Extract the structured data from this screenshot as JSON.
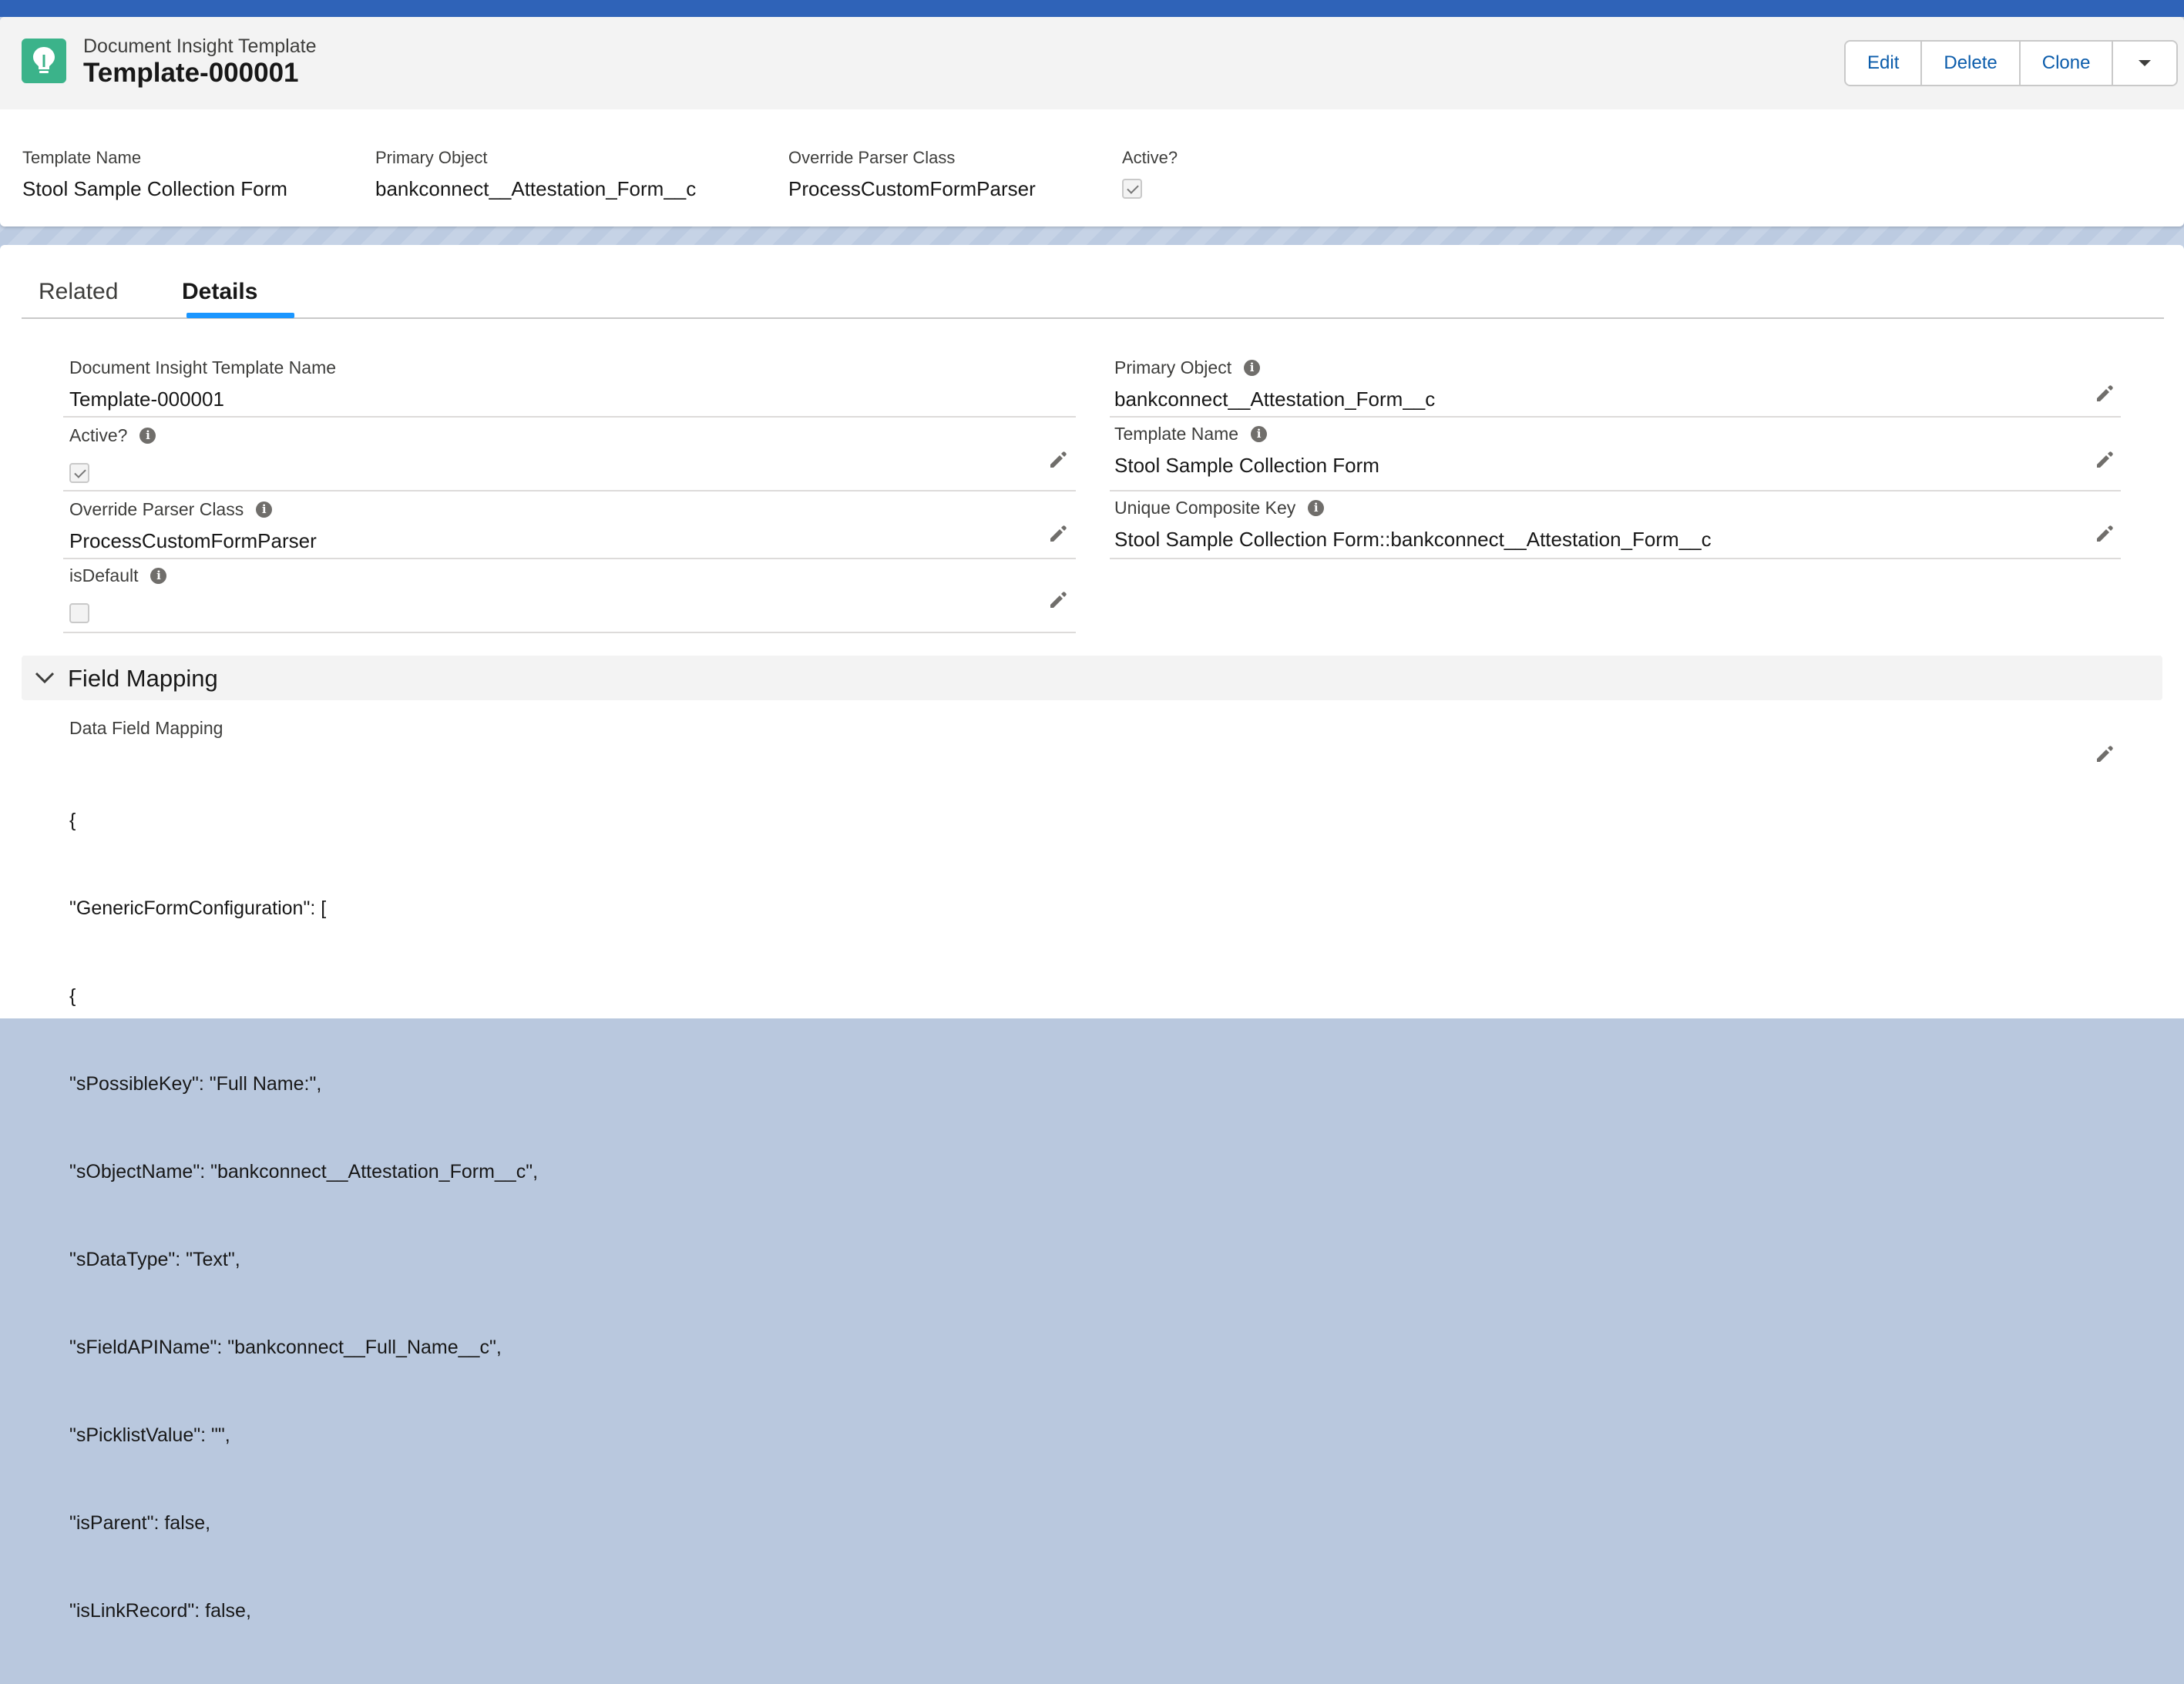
{
  "header": {
    "object_type": "Document Insight Template",
    "record_title": "Template-000001",
    "icon": "lightbulb-icon",
    "actions": [
      "Edit",
      "Delete",
      "Clone"
    ],
    "more_actions_icon": "chevron-down-icon"
  },
  "highlights": [
    {
      "label": "Template Name",
      "value": "Stool Sample Collection Form"
    },
    {
      "label": "Primary Object",
      "value": "bankconnect__Attestation_Form__c"
    },
    {
      "label": "Override Parser Class",
      "value": "ProcessCustomFormParser"
    },
    {
      "label": "Active?",
      "checked": true
    }
  ],
  "tabs": [
    "Related",
    "Details"
  ],
  "active_tab": "Details",
  "details": {
    "left": [
      {
        "label": "Document Insight Template Name",
        "value": "Template-000001",
        "info": false,
        "editable": false
      },
      {
        "label": "Active?",
        "checked": true,
        "info": true,
        "editable": true
      },
      {
        "label": "Override Parser Class",
        "value": "ProcessCustomFormParser",
        "info": true,
        "editable": true
      },
      {
        "label": "isDefault",
        "checked": false,
        "info": true,
        "editable": true
      }
    ],
    "right": [
      {
        "label": "Primary Object",
        "value": "bankconnect__Attestation_Form__c",
        "info": true,
        "editable": true
      },
      {
        "label": "Template Name",
        "value": "Stool Sample Collection Form",
        "info": true,
        "editable": true
      },
      {
        "label": "Unique Composite Key",
        "value": "Stool Sample Collection Form::bankconnect__Attestation_Form__c",
        "info": true,
        "editable": true
      }
    ]
  },
  "field_mapping": {
    "section_title": "Field Mapping",
    "label": "Data Field Mapping",
    "lines": [
      "{",
      "\"GenericFormConfiguration\": [",
      "{",
      "\"sPossibleKey\": \"Full Name:\",",
      "\"sObjectName\": \"bankconnect__Attestation_Form__c\",",
      "\"sDataType\": \"Text\",",
      "\"sFieldAPIName\": \"bankconnect__Full_Name__c\",",
      "\"sPicklistValue\": \"\",",
      "\"isParent\": false,",
      "\"isLinkRecord\": false,"
    ]
  },
  "colors": {
    "brand_blue": "#0b5cab",
    "tab_active_underline": "#1b96ff",
    "icon_green": "#3bb38a",
    "top_band": "#2f63b8"
  }
}
